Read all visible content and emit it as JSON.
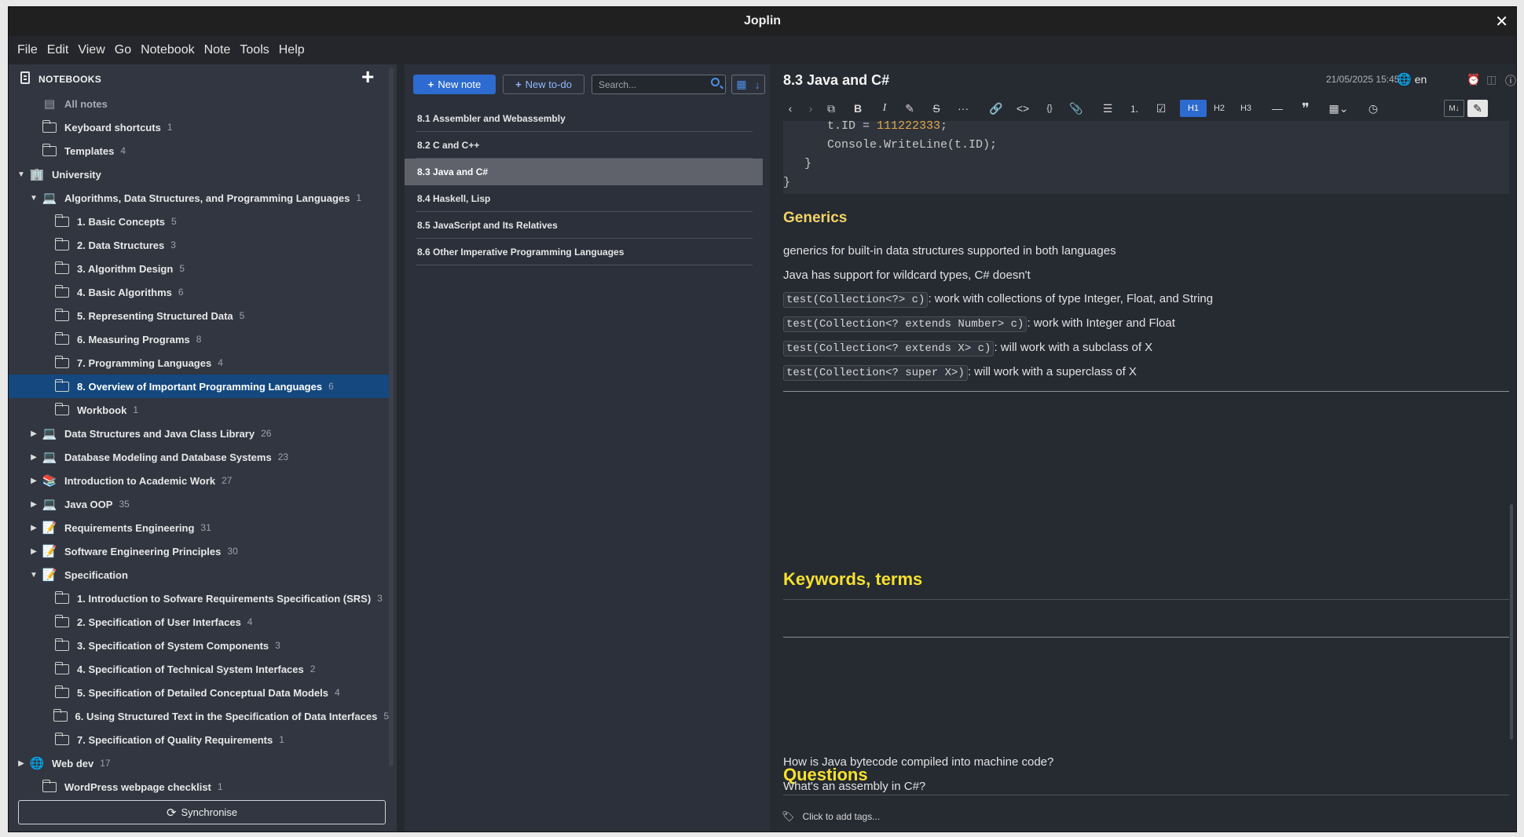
{
  "window": {
    "title": "Joplin"
  },
  "menu": [
    "File",
    "Edit",
    "View",
    "Go",
    "Notebook",
    "Note",
    "Tools",
    "Help"
  ],
  "sidebar": {
    "header": "NOTEBOOKS",
    "sync_label": "Synchronise",
    "items": [
      {
        "label": "All notes",
        "count": "",
        "level": 1,
        "arrow": "",
        "icon": "all-notes-icon",
        "glyph": "▤"
      },
      {
        "label": "Keyboard shortcuts",
        "count": "1",
        "level": 1,
        "arrow": "",
        "icon": "folder-icon"
      },
      {
        "label": "Templates",
        "count": "4",
        "level": 1,
        "arrow": "",
        "icon": "folder-icon"
      },
      {
        "label": "University",
        "count": "",
        "level": 0,
        "arrow": "▼",
        "icon": "office-building-icon",
        "glyph": "🏢"
      },
      {
        "label": "Algorithms, Data Structures, and Programming Languages",
        "count": "1",
        "level": 1,
        "arrow": "▼",
        "icon": "laptop-icon",
        "glyph": "💻"
      },
      {
        "label": "1. Basic Concepts",
        "count": "5",
        "level": 2,
        "arrow": "",
        "icon": "folder-icon"
      },
      {
        "label": "2. Data Structures",
        "count": "3",
        "level": 2,
        "arrow": "",
        "icon": "folder-icon"
      },
      {
        "label": "3. Algorithm Design",
        "count": "5",
        "level": 2,
        "arrow": "",
        "icon": "folder-icon"
      },
      {
        "label": "4. Basic Algorithms",
        "count": "6",
        "level": 2,
        "arrow": "",
        "icon": "folder-icon"
      },
      {
        "label": "5. Representing Structured Data",
        "count": "5",
        "level": 2,
        "arrow": "",
        "icon": "folder-icon"
      },
      {
        "label": "6. Measuring Programs",
        "count": "8",
        "level": 2,
        "arrow": "",
        "icon": "folder-icon"
      },
      {
        "label": "7. Programming Languages",
        "count": "4",
        "level": 2,
        "arrow": "",
        "icon": "folder-icon"
      },
      {
        "label": "8. Overview of Important Programming Languages",
        "count": "6",
        "level": 2,
        "arrow": "",
        "icon": "folder-icon",
        "selected": true
      },
      {
        "label": "Workbook",
        "count": "1",
        "level": 2,
        "arrow": "",
        "icon": "folder-icon"
      },
      {
        "label": "Data Structures and Java Class Library",
        "count": "26",
        "level": 1,
        "arrow": "▶",
        "icon": "laptop-icon",
        "glyph": "💻"
      },
      {
        "label": "Database Modeling and Database Systems",
        "count": "23",
        "level": 1,
        "arrow": "▶",
        "icon": "laptop-icon",
        "glyph": "💻"
      },
      {
        "label": "Introduction to Academic Work",
        "count": "27",
        "level": 1,
        "arrow": "▶",
        "icon": "books-icon",
        "glyph": "📚"
      },
      {
        "label": "Java OOP",
        "count": "35",
        "level": 1,
        "arrow": "▶",
        "icon": "laptop-icon",
        "glyph": "💻"
      },
      {
        "label": "Requirements Engineering",
        "count": "31",
        "level": 1,
        "arrow": "▶",
        "icon": "memo-icon",
        "glyph": "📝"
      },
      {
        "label": "Software Engineering Principles",
        "count": "30",
        "level": 1,
        "arrow": "▶",
        "icon": "memo-icon",
        "glyph": "📝"
      },
      {
        "label": "Specification",
        "count": "",
        "level": 1,
        "arrow": "▼",
        "icon": "memo-icon",
        "glyph": "📝"
      },
      {
        "label": "1. Introduction to Sofware Requirements Specification (SRS)",
        "count": "3",
        "level": 2,
        "arrow": "",
        "icon": "folder-icon"
      },
      {
        "label": "2. Specification of User Interfaces",
        "count": "4",
        "level": 2,
        "arrow": "",
        "icon": "folder-icon"
      },
      {
        "label": "3. Specification of System Components",
        "count": "3",
        "level": 2,
        "arrow": "",
        "icon": "folder-icon"
      },
      {
        "label": "4. Specification of Technical System Interfaces",
        "count": "2",
        "level": 2,
        "arrow": "",
        "icon": "folder-icon"
      },
      {
        "label": "5. Specification of Detailed Conceptual Data Models",
        "count": "4",
        "level": 2,
        "arrow": "",
        "icon": "folder-icon"
      },
      {
        "label": "6. Using Structured Text in the Specification of Data Interfaces",
        "count": "5",
        "level": 2,
        "arrow": "",
        "icon": "folder-icon"
      },
      {
        "label": "7. Specification of Quality Requirements",
        "count": "1",
        "level": 2,
        "arrow": "",
        "icon": "folder-icon"
      },
      {
        "label": "Web dev",
        "count": "17",
        "level": 0,
        "arrow": "▶",
        "icon": "globe-icon",
        "glyph": "🌐"
      },
      {
        "label": "WordPress webpage checklist",
        "count": "1",
        "level": 1,
        "arrow": "",
        "icon": "folder-icon"
      }
    ]
  },
  "notelist": {
    "new_note": "New note",
    "new_todo": "New to-do",
    "search_placeholder": "Search...",
    "notes": [
      {
        "title": "8.1 Assembler and Webassembly"
      },
      {
        "title": "8.2 C and C++"
      },
      {
        "title": "8.3 Java and C#",
        "selected": true
      },
      {
        "title": "8.4 Haskell, Lisp"
      },
      {
        "title": "8.5 JavaScript and Its Relatives"
      },
      {
        "title": "8.6 Other Imperative Programming Languages"
      }
    ]
  },
  "editor": {
    "title": "8.3 Java and C#",
    "date": "21/05/2025 15:45",
    "language": "en",
    "toolbar": {
      "h1": "H1",
      "h2": "H2",
      "h3": "H3"
    },
    "code": {
      "line1_prefix": "t.ID = ",
      "line1_number": "111222333",
      "line1_suffix": ";",
      "line2": "Console.WriteLine(t.ID);",
      "line3": "}",
      "line4": "}"
    },
    "generics_heading": "Generics",
    "para1": "generics for built-in data structures supported in both languages",
    "para2": "Java has support for wildcard types, C# doesn't",
    "wild": [
      {
        "code": "test(Collection<?> c)",
        "text": ": work with collections of type Integer, Float, and String"
      },
      {
        "code": "test(Collection<? extends Number> c)",
        "text": ": work with Integer and Float"
      },
      {
        "code": "test(Collection<? extends X> c)",
        "text": ": will work with a subclass of X"
      },
      {
        "code": "test(Collection<? super X>)",
        "text": ": will work with a superclass of X"
      }
    ],
    "keywords_heading": "Keywords, terms",
    "questions_heading": "Questions",
    "q1": "How is Java bytecode compiled into machine code?",
    "q2": "What's an assembly in C#?",
    "tags_placeholder": "Click to add tags..."
  }
}
